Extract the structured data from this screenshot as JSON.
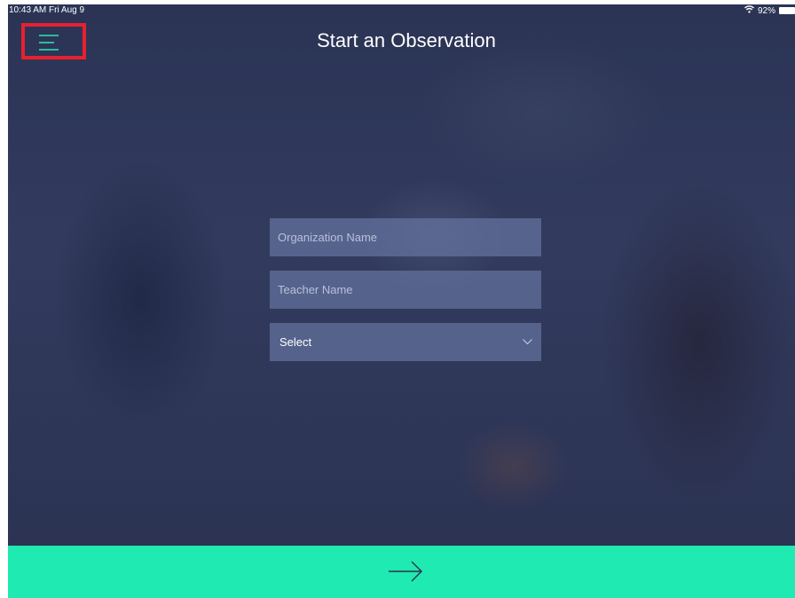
{
  "status_bar": {
    "time": "10:43 AM  Fri Aug 9",
    "battery": "92%",
    "wifi_icon": "wifi-icon"
  },
  "header": {
    "title": "Start an Observation",
    "menu_icon": "hamburger-menu-icon",
    "menu_highlight_color": "#e8202f"
  },
  "form": {
    "organization": {
      "placeholder": "Organization Name",
      "value": ""
    },
    "teacher": {
      "placeholder": "Teacher Name",
      "value": ""
    },
    "select": {
      "value": "Select",
      "icon": "chevron-down-icon"
    }
  },
  "footer": {
    "next_icon": "arrow-right-icon",
    "accent_color": "#1eeab1"
  }
}
